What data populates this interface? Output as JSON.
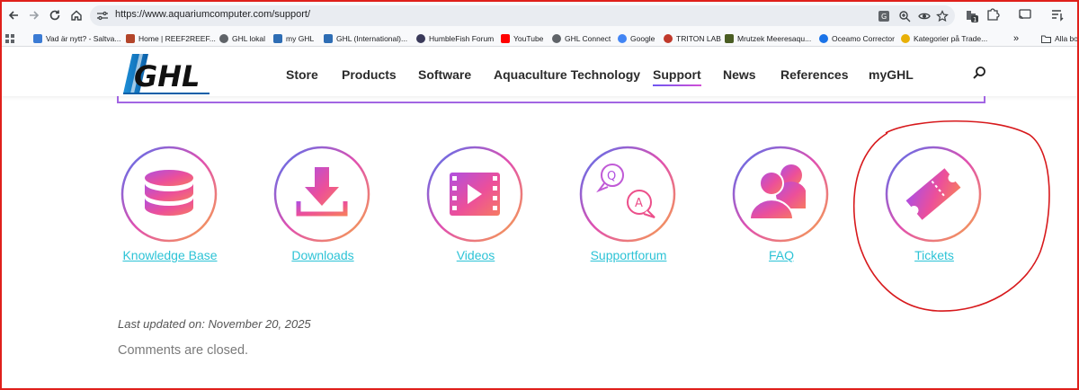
{
  "browser": {
    "url": "https://www.aquariumcomputer.com/support/",
    "extension_badge": "1"
  },
  "bookmarks": [
    {
      "label": "Vad är nytt? - Saltva...",
      "icon": "sg-icon",
      "color": "#3b7bd4"
    },
    {
      "label": "Home | REEF2REEF...",
      "icon": "reef2reef-icon",
      "color": "#b3452a"
    },
    {
      "label": "GHL lokal",
      "icon": "globe-icon",
      "color": "#5f6368"
    },
    {
      "label": "my GHL",
      "icon": "ghl-icon",
      "color": "#2e6db4"
    },
    {
      "label": "GHL (International)...",
      "icon": "ghl-icon",
      "color": "#2e6db4"
    },
    {
      "label": "HumbleFish Forum",
      "icon": "humblefish-icon",
      "color": "#3a3a5a"
    },
    {
      "label": "YouTube",
      "icon": "youtube-icon",
      "color": "#ff0000"
    },
    {
      "label": "GHL Connect",
      "icon": "globe-icon",
      "color": "#5f6368"
    },
    {
      "label": "Google",
      "icon": "google-icon",
      "color": "#4285f4"
    },
    {
      "label": "TRITON LAB",
      "icon": "triton-icon",
      "color": "#c0392b"
    },
    {
      "label": "Mrutzek Meeresaqu...",
      "icon": "mrutzek-icon",
      "color": "#4a5d23"
    },
    {
      "label": "Oceamo Corrector",
      "icon": "oceamo-icon",
      "color": "#1a73e8"
    },
    {
      "label": "Kategorier på Trade...",
      "icon": "trade-icon",
      "color": "#e8b007"
    }
  ],
  "bookmarks_overflow": "»",
  "all_bookmarks_label": "Alla bo",
  "site": {
    "logo_text": "GHL",
    "menu": [
      "Store",
      "Products",
      "Software",
      "Aquaculture Technology",
      "Support",
      "News",
      "References",
      "myGHL"
    ],
    "active_menu": "Support"
  },
  "support_links": [
    {
      "label": "Knowledge Base",
      "icon": "database-icon"
    },
    {
      "label": "Downloads",
      "icon": "download-icon"
    },
    {
      "label": "Videos",
      "icon": "video-icon"
    },
    {
      "label": "Supportforum",
      "icon": "qa-chat-icon"
    },
    {
      "label": "FAQ",
      "icon": "users-icon"
    },
    {
      "label": "Tickets",
      "icon": "ticket-icon"
    }
  ],
  "last_updated": "Last updated on: November 20, 2025",
  "comments_closed": "Comments are closed.",
  "colors": {
    "gradient_start": "#5b6cf0",
    "gradient_mid": "#e94fa8",
    "gradient_end": "#f6a24a",
    "link": "#2cc3d6",
    "annotation": "#d7191c"
  }
}
